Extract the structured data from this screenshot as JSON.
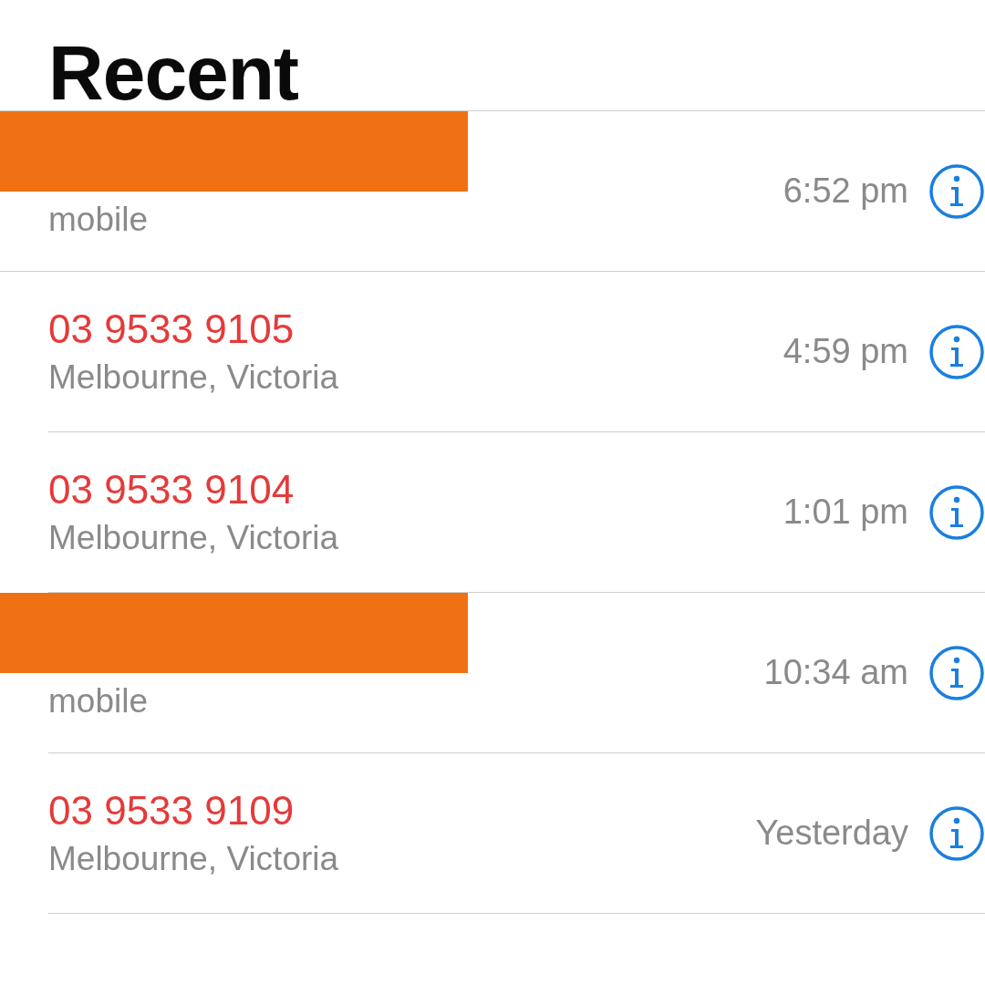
{
  "title": "Recent",
  "calls": [
    {
      "kind": "redacted",
      "subtitle": "mobile",
      "time": "6:52 pm"
    },
    {
      "kind": "number",
      "number": "03 9533 9105",
      "missed": true,
      "subtitle": "Melbourne, Victoria",
      "time": "4:59 pm"
    },
    {
      "kind": "number",
      "number": "03 9533 9104",
      "missed": true,
      "subtitle": "Melbourne, Victoria",
      "time": "1:01 pm"
    },
    {
      "kind": "redacted",
      "subtitle": "mobile",
      "time": "10:34 am"
    },
    {
      "kind": "number",
      "number": "03 9533 9109",
      "missed": true,
      "subtitle": "Melbourne, Victoria",
      "time": "Yesterday"
    }
  ]
}
